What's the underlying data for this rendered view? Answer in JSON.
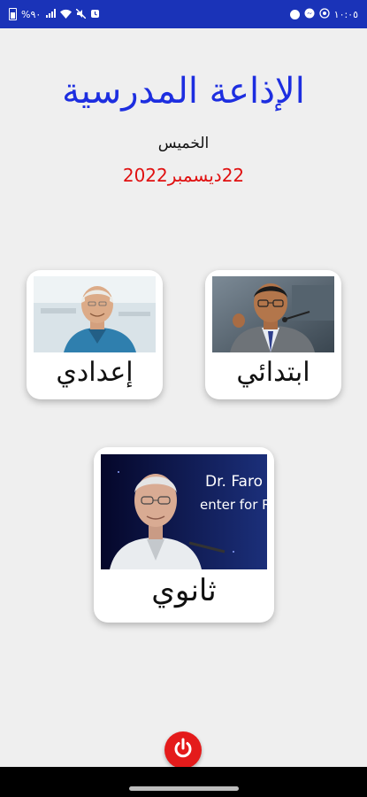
{
  "status_bar": {
    "time": "١٠:٠٥",
    "battery_text": "%٩٠",
    "background": "#1a33b8",
    "icons": [
      "battery-icon",
      "signal-icon",
      "wifi-icon",
      "mute-icon",
      "alarm-icon",
      "messenger-icon",
      "whatsapp-icon",
      "notification-icon"
    ]
  },
  "header": {
    "title": "الإذاعة المدرسية",
    "day": "الخميس",
    "date": "22ديسمبر2022",
    "title_color": "#1d2ee0",
    "date_color": "#e01010"
  },
  "cards": {
    "primary": {
      "label": "ابتدائي"
    },
    "preparatory": {
      "label": "إعدادي"
    },
    "secondary": {
      "label": "ثانوي",
      "photo_text": "Dr. Faro\nenter for R"
    }
  },
  "power_button": {
    "icon": "power-icon",
    "color": "#e41b1b"
  }
}
